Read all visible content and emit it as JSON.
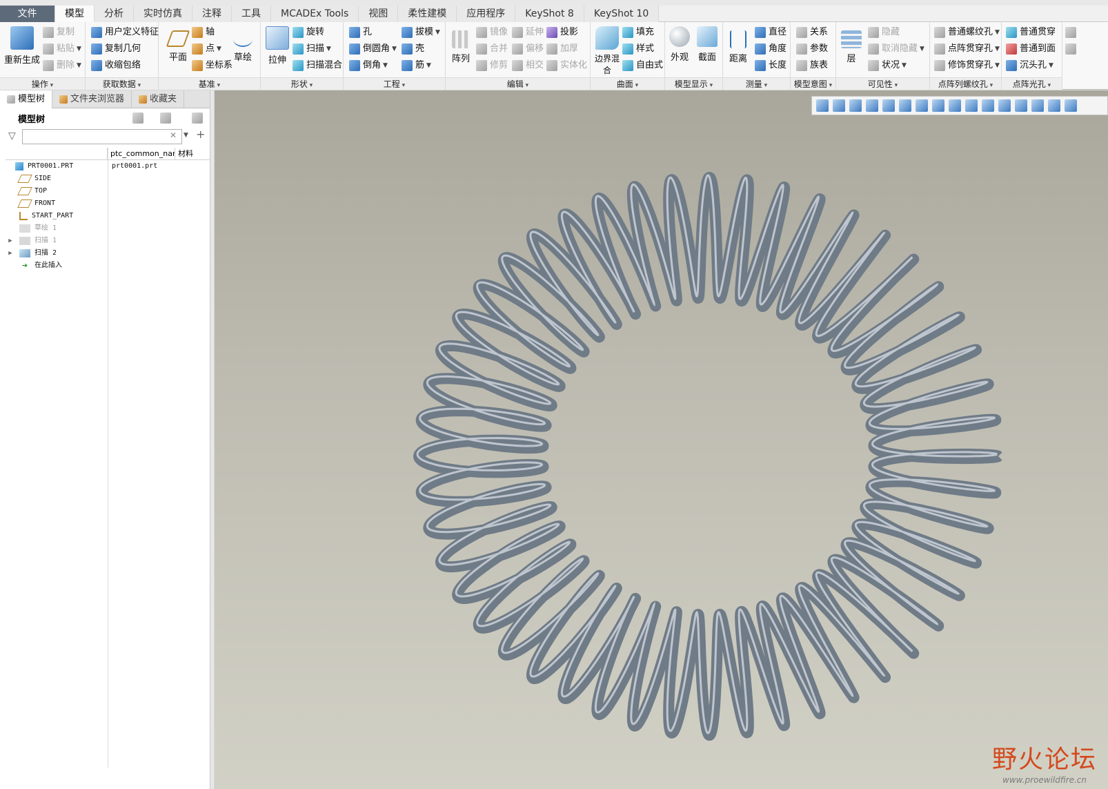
{
  "tabs": [
    "文件",
    "模型",
    "分析",
    "实时仿真",
    "注释",
    "工具",
    "MCADEx Tools",
    "视图",
    "柔性建模",
    "应用程序",
    "KeyShot 8",
    "KeyShot 10"
  ],
  "ribbon": {
    "operation": {
      "label": "操作",
      "regenerate": "重新生成",
      "copy": "复制",
      "paste": "粘贴",
      "delete": "删除"
    },
    "get_data": {
      "label": "获取数据",
      "udf": "用户定义特征",
      "copy_geom": "复制几何",
      "shrinkwrap": "收缩包络"
    },
    "datum": {
      "label": "基准",
      "plane": "平面",
      "axis": "轴",
      "point": "点",
      "csys": "坐标系",
      "sketch": "草绘"
    },
    "shapes": {
      "label": "形状",
      "extrude": "拉伸",
      "revolve": "旋转",
      "sweep": "扫描",
      "swept_blend": "扫描混合"
    },
    "engineering": {
      "label": "工程",
      "hole": "孔",
      "round": "倒圆角",
      "chamfer": "倒角",
      "draft": "拔模",
      "shell": "壳",
      "rib": "筋"
    },
    "editing": {
      "label": "编辑",
      "pattern": "阵列",
      "mirror": "镜像",
      "merge": "合并",
      "trim": "修剪",
      "extend": "延伸",
      "offset": "偏移",
      "intersect": "相交",
      "project": "投影",
      "thicken": "加厚",
      "solidify": "实体化"
    },
    "surfaces": {
      "label": "曲面",
      "boundary_blend": "边界混合",
      "fill": "填充",
      "style": "样式",
      "freestyle": "自由式"
    },
    "model_display": {
      "label": "模型显示",
      "appearance": "外观",
      "section": "截面"
    },
    "measure": {
      "label": "测量",
      "distance": "距离",
      "diameter": "直径",
      "angle": "角度",
      "length": "长度"
    },
    "model_intent": {
      "label": "模型意图",
      "relations": "关系",
      "parameters": "参数",
      "family_table": "族表"
    },
    "visibility": {
      "label": "可见性",
      "layers": "层",
      "hide": "隐藏",
      "unhide": "取消隐藏",
      "status": "状况"
    },
    "pattern_thread": {
      "label": "点阵列螺纹孔",
      "normal_thread": "普通螺纹孔",
      "pattern_through": "点阵贯穿孔",
      "cosmetic_thread": "修饰贯穿孔"
    },
    "pattern_plain": {
      "label": "点阵光孔",
      "normal_through": "普通贯穿",
      "normal_to_face": "普通到面",
      "countersink": "沉头孔"
    }
  },
  "panel": {
    "tabs": [
      "模型树",
      "文件夹浏览器",
      "收藏夹"
    ],
    "header": "模型树",
    "columns": [
      "ptc_common_name",
      "材料"
    ],
    "rows": [
      {
        "name": "PRT0001.PRT",
        "common": "prt0001.prt"
      },
      {
        "name": "SIDE"
      },
      {
        "name": "TOP"
      },
      {
        "name": "FRONT"
      },
      {
        "name": "START_PART"
      },
      {
        "name": "草绘 1"
      },
      {
        "name": "扫描 1"
      },
      {
        "name": "扫描 2"
      },
      {
        "name": "在此插入"
      }
    ]
  },
  "watermark": {
    "title": "野火论坛",
    "url": "www.proewildfire.cn"
  },
  "colors": {
    "spring": "#6f7b86",
    "spring_highlight": "#dfe6ec",
    "accent_tab": "#5d6a7a"
  }
}
